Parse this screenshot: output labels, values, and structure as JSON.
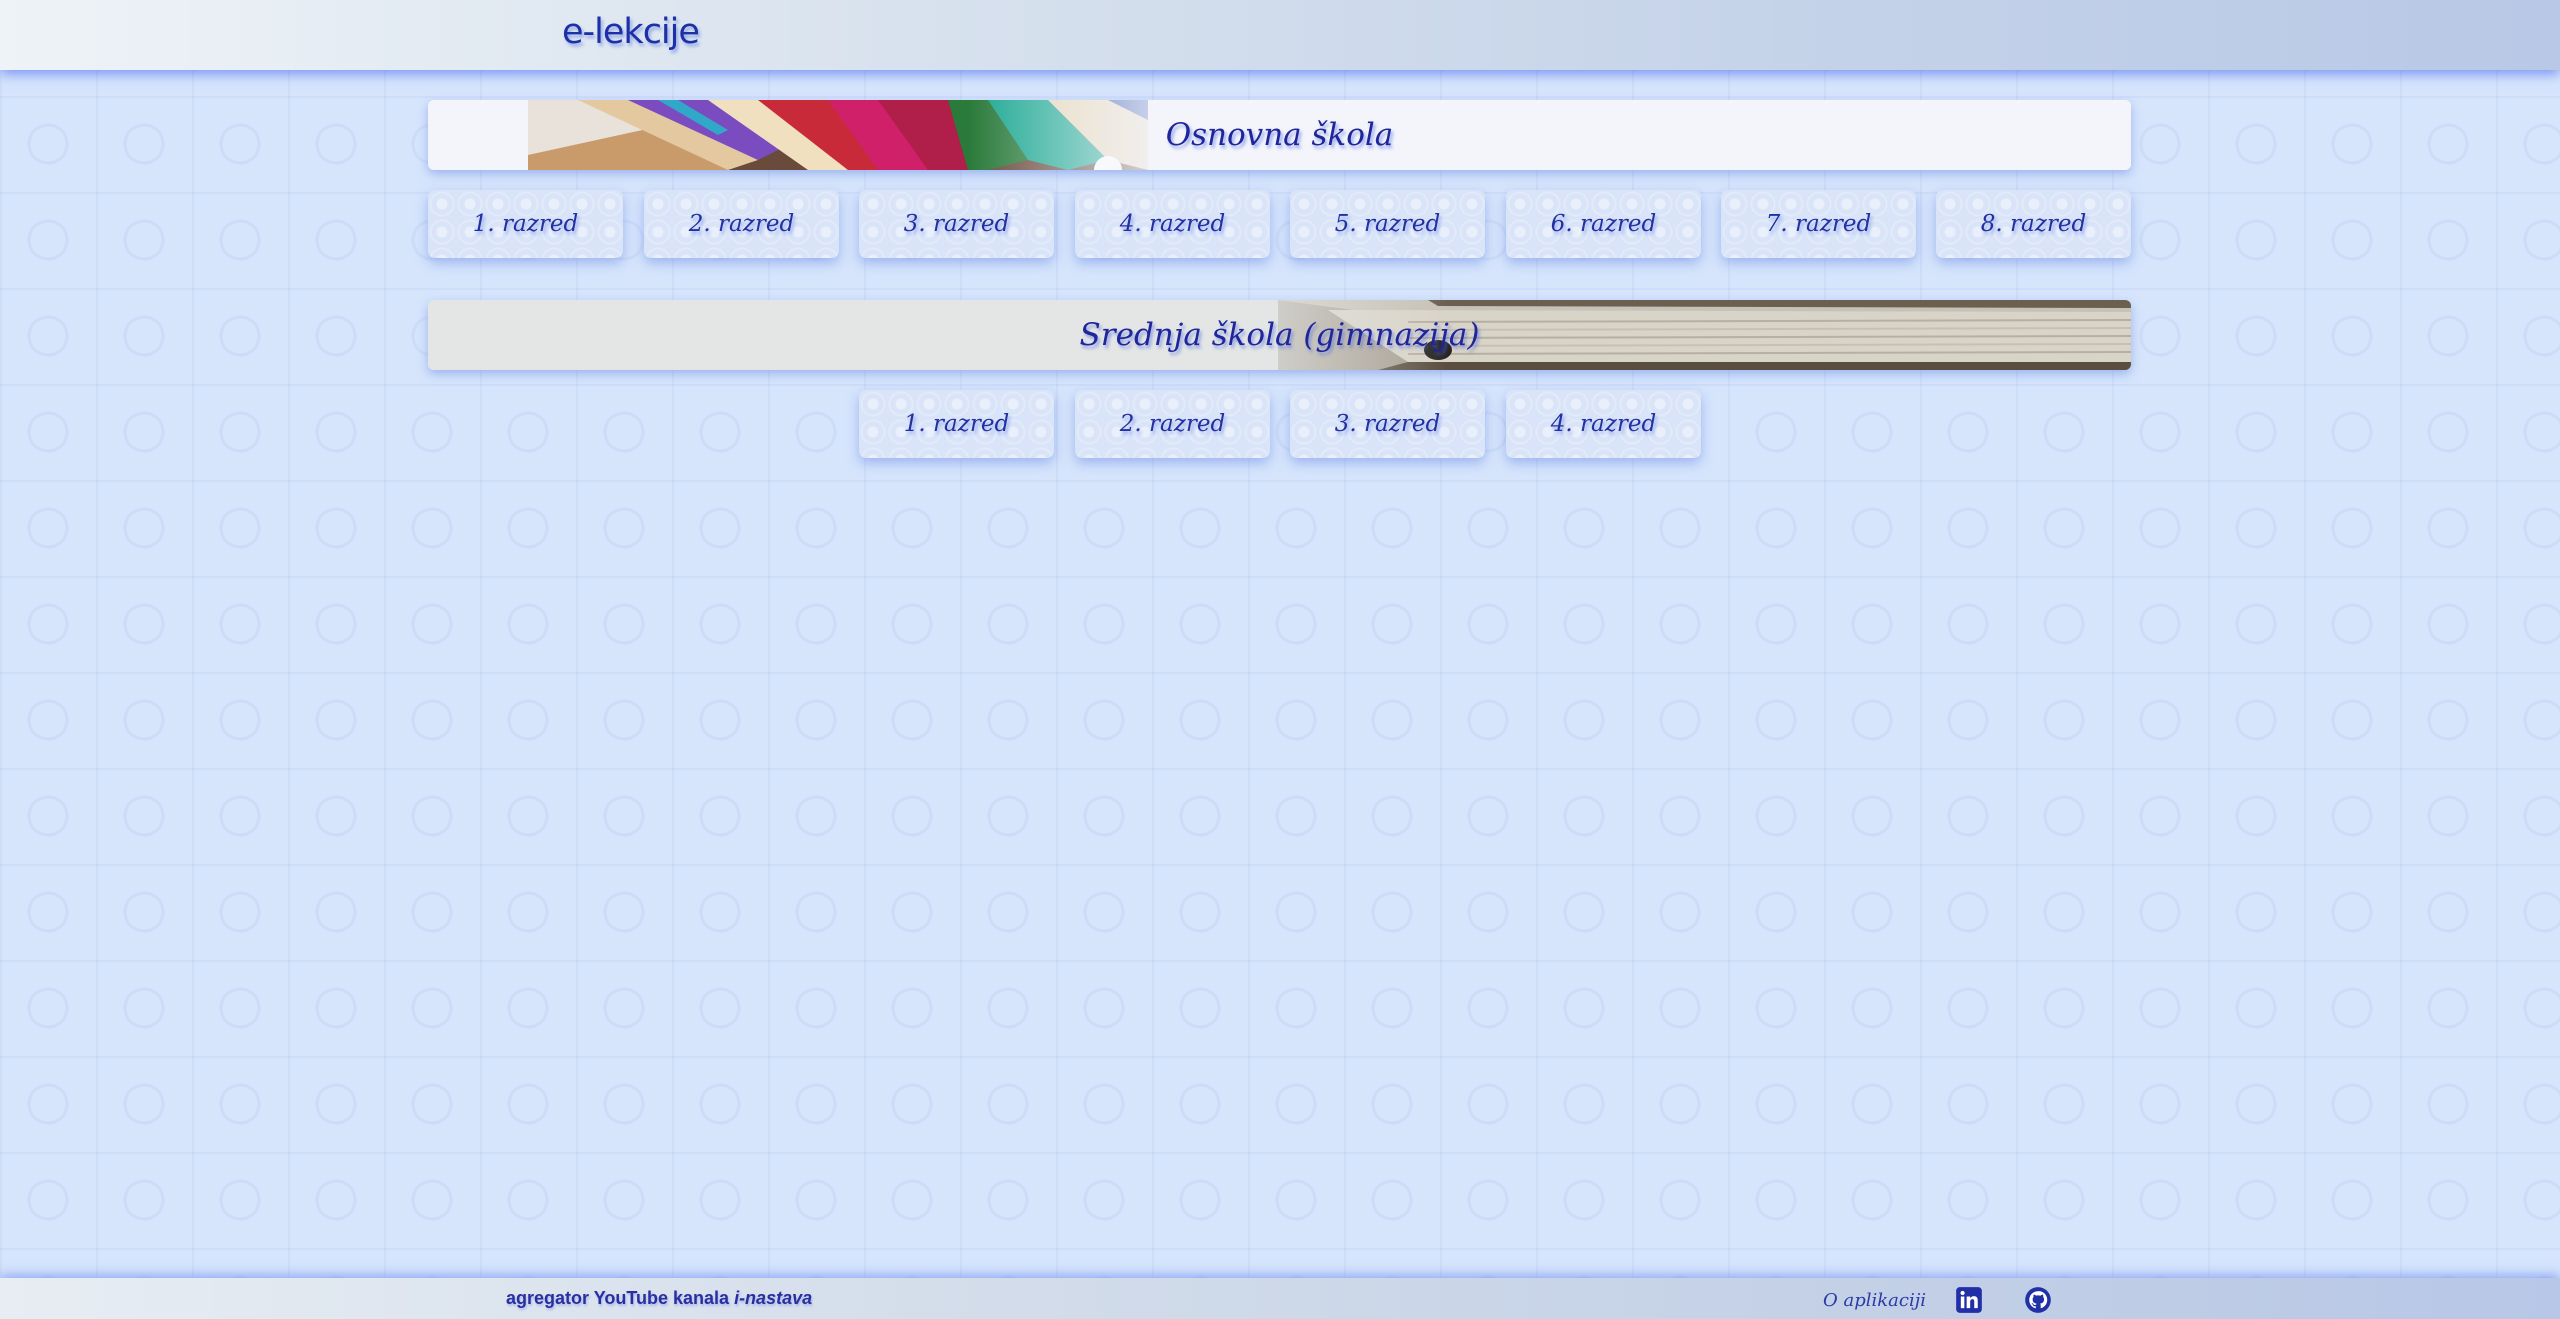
{
  "header": {
    "logo": "e-lekcije"
  },
  "sections": [
    {
      "title": "Osnovna škola",
      "grades": [
        "1. razred",
        "2. razred",
        "3. razred",
        "4. razred",
        "5. razred",
        "6. razred",
        "7. razred",
        "8. razred"
      ]
    },
    {
      "title": "Srednja škola (gimnazija)",
      "grades": [
        "1. razred",
        "2. razred",
        "3. razred",
        "4. razred"
      ]
    }
  ],
  "footer": {
    "tagline_prefix": "agregator YouTube kanala ",
    "tagline_emphasis": "i-nastava",
    "apps_link": "O aplikaciji",
    "icons": [
      "linkedin-icon",
      "github-icon"
    ]
  },
  "colors": {
    "text_primary": "#2330a0",
    "accent_glow": "#5a78f0",
    "background": "#d6e5fc"
  }
}
